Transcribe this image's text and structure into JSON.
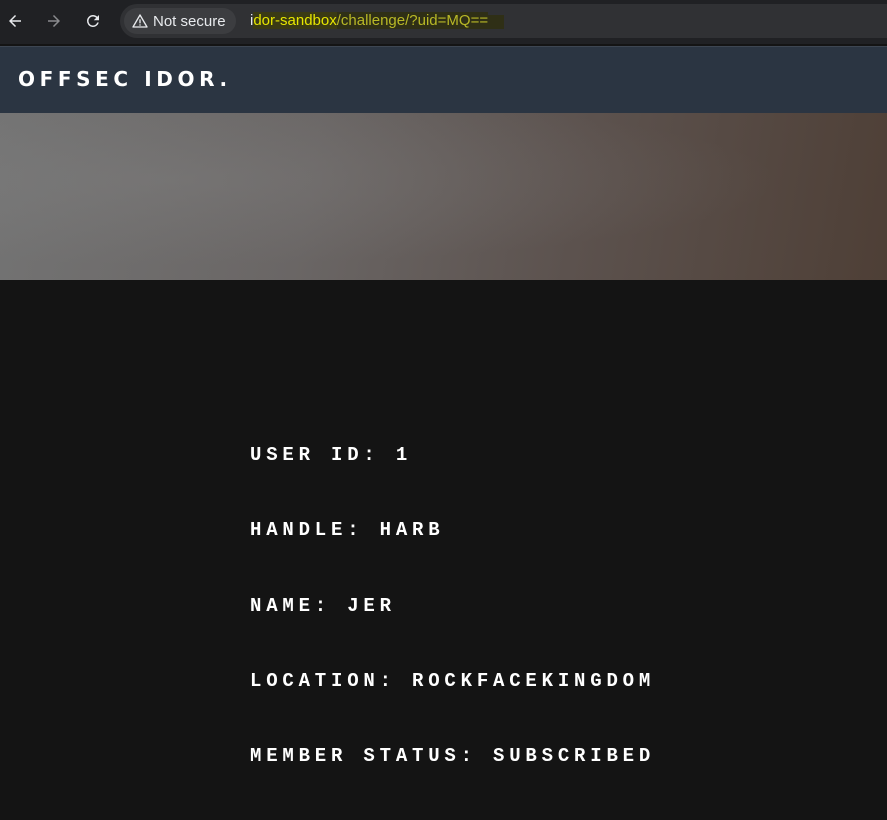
{
  "browser": {
    "security_label": "Not secure",
    "url_host_prefix": "i",
    "url_host_highlight": "dor-sandbox",
    "url_path": "/challenge/?uid=MQ==",
    "icons": {
      "back": "back-arrow-icon",
      "forward": "forward-arrow-icon",
      "reload": "reload-icon",
      "security": "warning-triangle-icon"
    }
  },
  "site": {
    "logo": "OFFSEC IDOR."
  },
  "profile": {
    "lines": [
      "USER ID: 1",
      "HANDLE: HARB",
      "NAME: JER",
      "LOCATION: ROCKFACEKINGDOM",
      "MEMBER STATUS: SUBSCRIBED"
    ]
  },
  "colors": {
    "header_bg": "#2b3542",
    "page_bg": "#141414",
    "text": "#ffffff"
  }
}
